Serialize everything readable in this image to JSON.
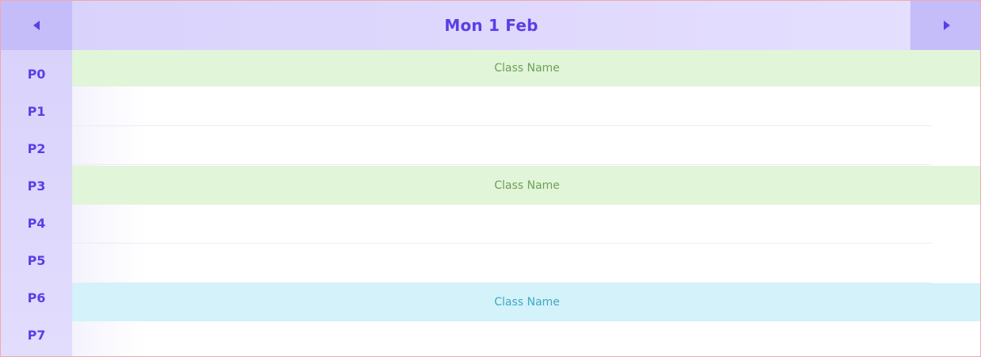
{
  "header": {
    "date_title": "Mon 1 Feb",
    "prev_icon": "triangle-left-icon",
    "next_icon": "triangle-right-icon"
  },
  "periods": [
    "P0",
    "P1",
    "P2",
    "P3",
    "P4",
    "P5",
    "P6",
    "P7"
  ],
  "classes": [
    {
      "period": "P0",
      "label": "Class Name",
      "color": "#e1f5d8",
      "text_color": "#6fa05a"
    },
    {
      "period": "P3",
      "label": "Class Name",
      "color": "#e1f5d8",
      "text_color": "#6fa05a"
    },
    {
      "period": "P6",
      "label": "Class Name",
      "color": "#d3f2f9",
      "text_color": "#3fa8c2"
    }
  ],
  "colors": {
    "accent": "#5b3fe6",
    "header_bg": "#dfd8fd",
    "nav_bg": "#c5bcfa"
  }
}
